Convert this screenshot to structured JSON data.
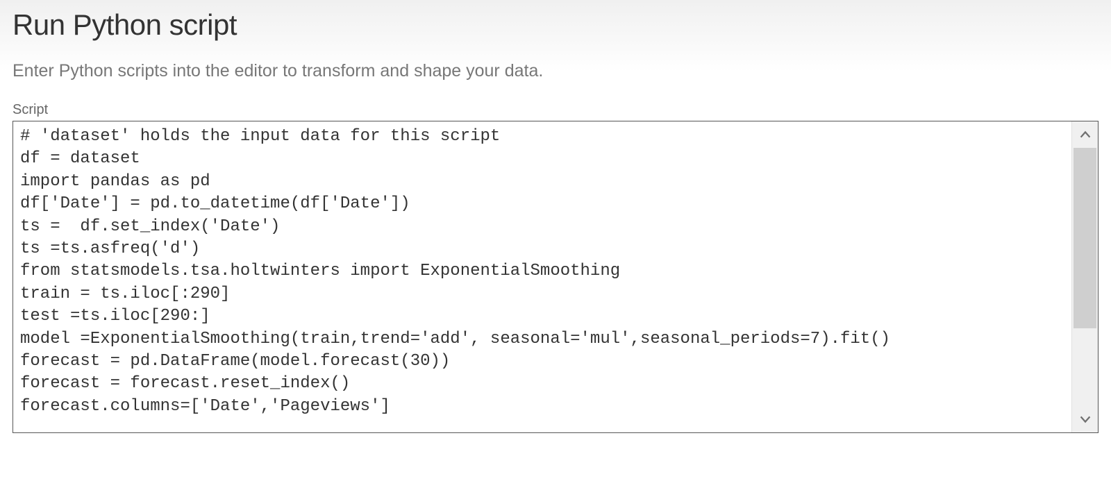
{
  "dialog": {
    "title": "Run Python script",
    "subtitle": "Enter Python scripts into the editor to transform and shape your data.",
    "script_label": "Script",
    "script_value": "# 'dataset' holds the input data for this script\ndf = dataset\nimport pandas as pd\ndf['Date'] = pd.to_datetime(df['Date'])\nts =  df.set_index('Date')\nts =ts.asfreq('d')\nfrom statsmodels.tsa.holtwinters import ExponentialSmoothing\ntrain = ts.iloc[:290]\ntest =ts.iloc[290:]\nmodel =ExponentialSmoothing(train,trend='add', seasonal='mul',seasonal_periods=7).fit()\nforecast = pd.DataFrame(model.forecast(30))\nforecast = forecast.reset_index()\nforecast.columns=['Date','Pageviews']"
  }
}
